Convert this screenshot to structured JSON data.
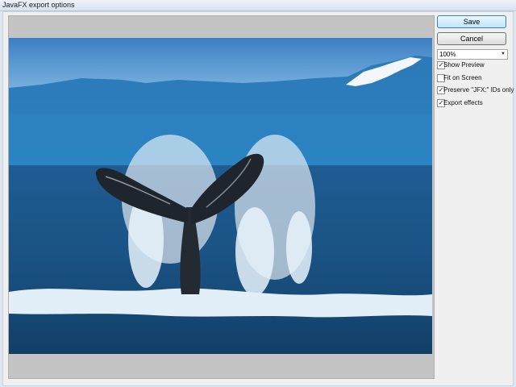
{
  "window": {
    "title": "JavaFX export options"
  },
  "preview": {
    "image_description_icon": "whale-tail-photo"
  },
  "actions": {
    "save_label": "Save",
    "cancel_label": "Cancel"
  },
  "zoom": {
    "selected": "100%",
    "icon": "chevron-down-icon"
  },
  "options": [
    {
      "label": "Show Preview",
      "checked": true
    },
    {
      "label": "Fit on Screen",
      "checked": false
    },
    {
      "label": "Preserve \"JFX:\" IDs only",
      "checked": true
    },
    {
      "label": "Export effects",
      "checked": true
    }
  ],
  "checkmark_glyph": "✓"
}
